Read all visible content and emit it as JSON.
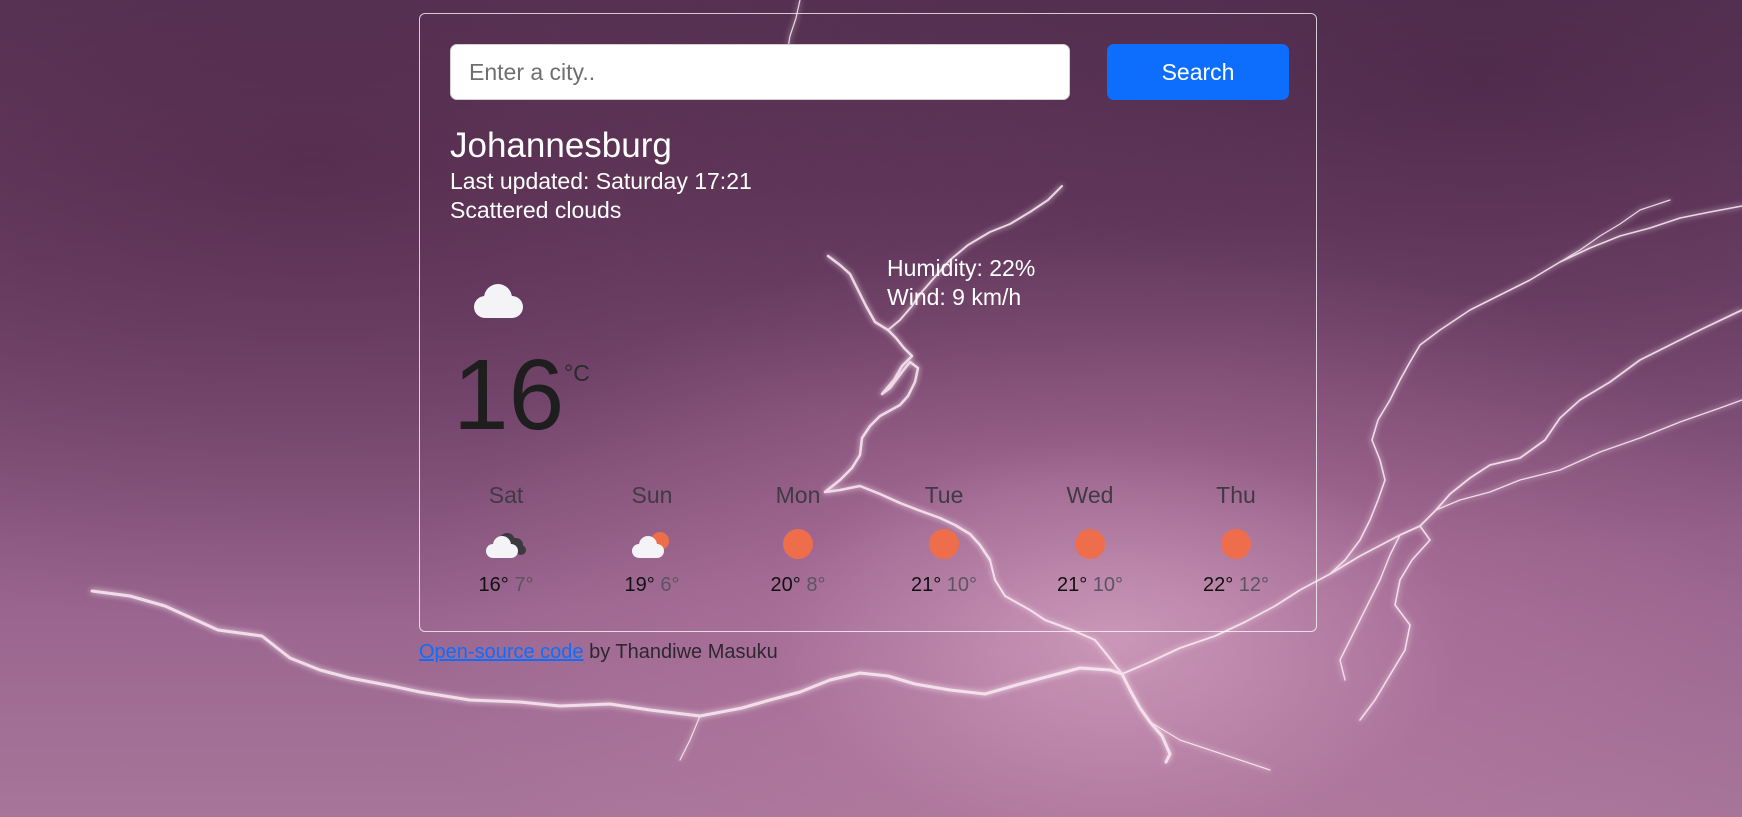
{
  "search": {
    "placeholder": "Enter a city..",
    "value": "",
    "button_label": "Search"
  },
  "current": {
    "city": "Johannesburg",
    "last_updated": "Last updated: Saturday 17:21",
    "description": "Scattered clouds",
    "icon": "cloud-icon",
    "temperature": "16",
    "unit": "°C",
    "humidity": "Humidity: 22%",
    "wind": "Wind: 9 km/h"
  },
  "forecast": [
    {
      "day": "Sat",
      "icon": "cloudy-icon",
      "max": "16°",
      "min": "7°"
    },
    {
      "day": "Sun",
      "icon": "partly-cloudy-icon",
      "max": "19°",
      "min": "6°"
    },
    {
      "day": "Mon",
      "icon": "sun-icon",
      "max": "20°",
      "min": "8°"
    },
    {
      "day": "Tue",
      "icon": "sun-icon",
      "max": "21°",
      "min": "10°"
    },
    {
      "day": "Wed",
      "icon": "sun-icon",
      "max": "21°",
      "min": "10°"
    },
    {
      "day": "Thu",
      "icon": "sun-icon",
      "max": "22°",
      "min": "12°"
    }
  ],
  "footer": {
    "link_text": "Open-source code",
    "suffix": " by Thandiwe Masuku"
  },
  "colors": {
    "accent": "#0d6efd",
    "sun": "#ee6e4b",
    "background": "#7b4b74"
  }
}
